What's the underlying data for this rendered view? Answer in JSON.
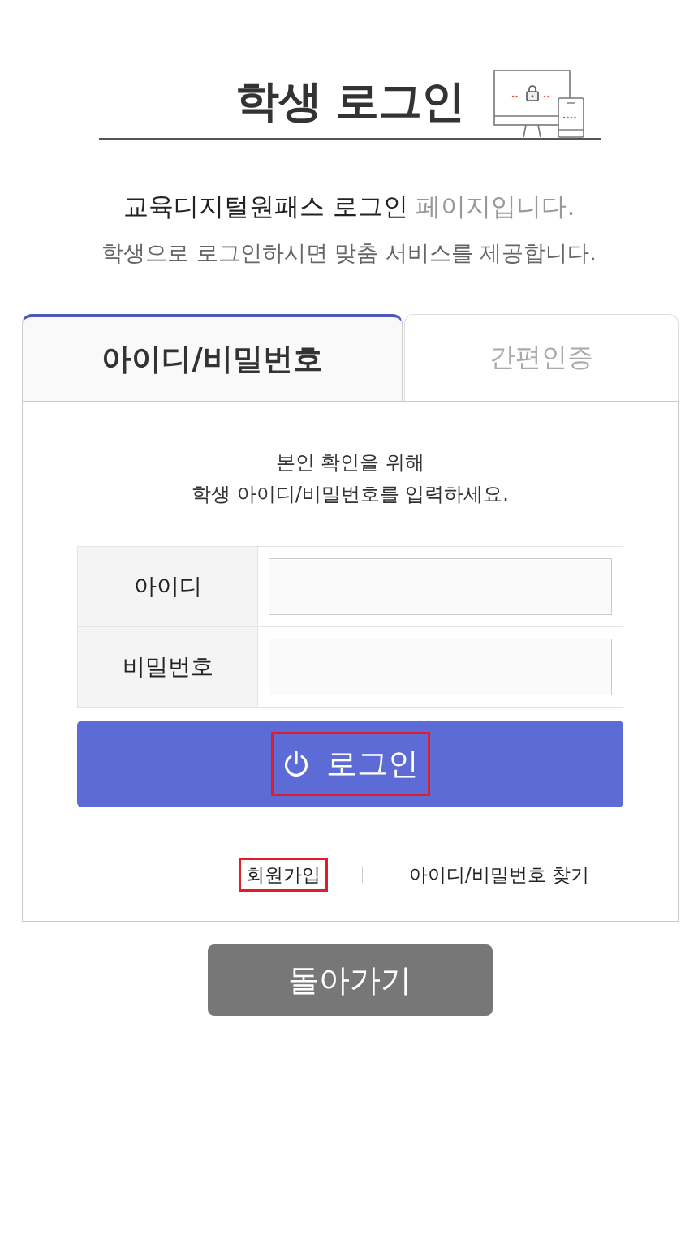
{
  "title": "학생 로그인",
  "intro": {
    "lead": "교육디지털원패스 로그인",
    "tail": "페이지입니다."
  },
  "subtitle": "학생으로 로그인하시면 맞춤 서비스를 제공합니다.",
  "tabs": [
    {
      "label": "아이디/비밀번호",
      "selected": true
    },
    {
      "label": "간편인증",
      "selected": false
    }
  ],
  "instruction": [
    "본인 확인을 위해",
    "학생 아이디/비밀번호를 입력하세요."
  ],
  "fields": [
    {
      "label": "아이디"
    },
    {
      "label": "비밀번호"
    }
  ],
  "login_button": {
    "label": "로그인",
    "highlighted": true
  },
  "links": [
    {
      "label": "회원가입",
      "highlighted": true
    },
    {
      "label": "아이디/비밀번호 찾기",
      "highlighted": false
    }
  ],
  "back_button": {
    "label": "돌아가기"
  }
}
